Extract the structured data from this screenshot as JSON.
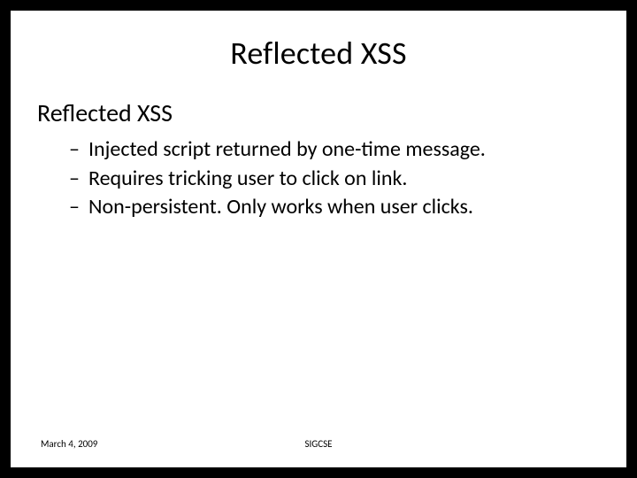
{
  "slide": {
    "title": "Reflected XSS",
    "subtitle": "Reflected XSS",
    "bullets": [
      "Injected script returned by one-time message.",
      "Requires tricking user to click on link.",
      "Non-persistent.  Only works when user clicks."
    ],
    "footer": {
      "date": "March 4, 2009",
      "venue": "SIGCSE"
    }
  }
}
